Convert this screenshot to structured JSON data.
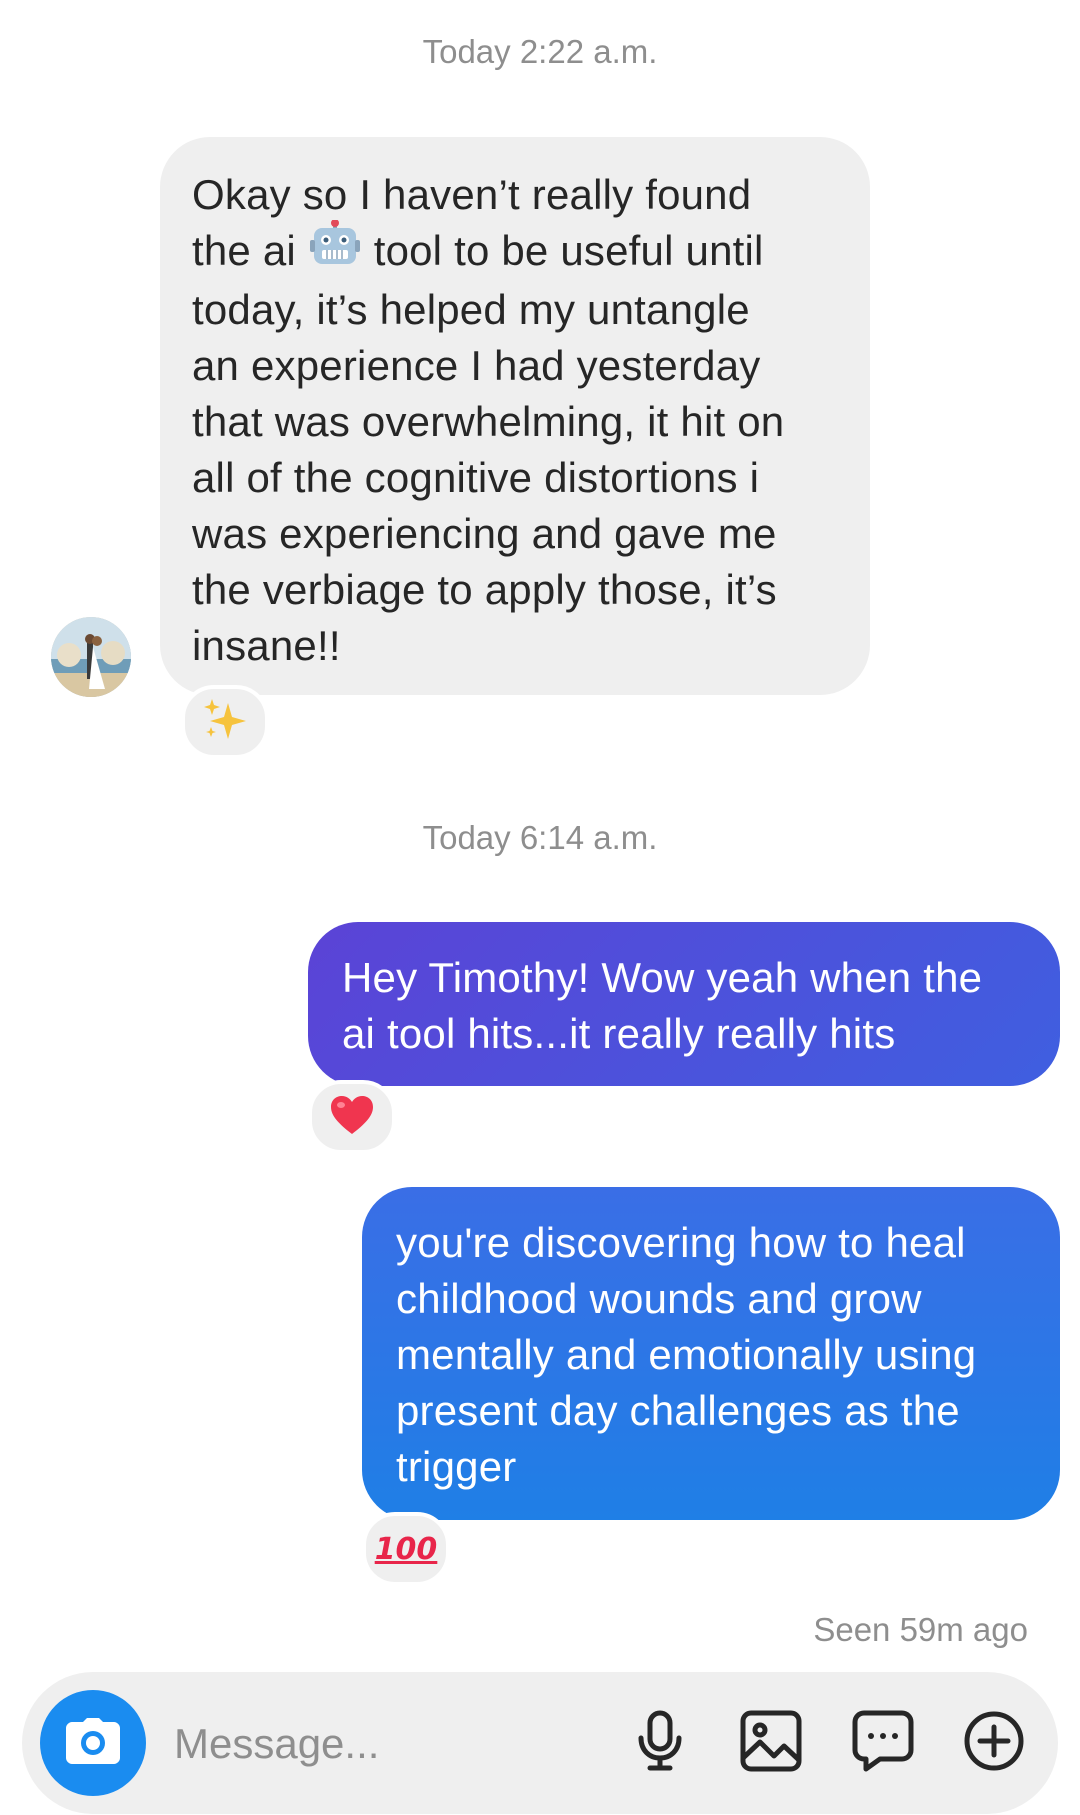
{
  "timestamps": {
    "first": "Today 2:22 a.m.",
    "second": "Today 6:14 a.m."
  },
  "messages": {
    "incoming_1": {
      "part_before_emoji": "Okay so I haven’t really found\nthe ai ",
      "inline_emoji": "robot-face-emoji",
      "part_after_emoji": " tool to be useful until\ntoday, it’s helped my untangle\nan experience I had yesterday\nthat was overwhelming, it hit on\nall of the cognitive distortions i\nwas experiencing and gave me\nthe verbiage to apply those, it’s\ninsane!!",
      "reaction": "sparkles-emoji"
    },
    "outgoing_1": {
      "text": "Hey Timothy! Wow yeah when the\nai tool hits...it really really hits",
      "reaction": "red-heart-emoji"
    },
    "outgoing_2": {
      "text": "you're discovering how to heal\nchildhood wounds and grow\nmentally and emotionally using\npresent day challenges as the\ntrigger",
      "reaction": "hundred-points-emoji",
      "reaction_text": "100"
    }
  },
  "status": {
    "seen": "Seen 59m ago"
  },
  "composer": {
    "placeholder": "Message...",
    "icons": [
      "camera-icon",
      "microphone-icon",
      "gallery-icon",
      "sticker-icon",
      "add-icon"
    ]
  },
  "colors": {
    "incoming_bubble": "#efefef",
    "outgoing_bubble_1": "#4b52de",
    "outgoing_bubble_2": "#2277e8",
    "camera_button": "#1a8cf0",
    "meta_text": "#8e8e8e"
  }
}
